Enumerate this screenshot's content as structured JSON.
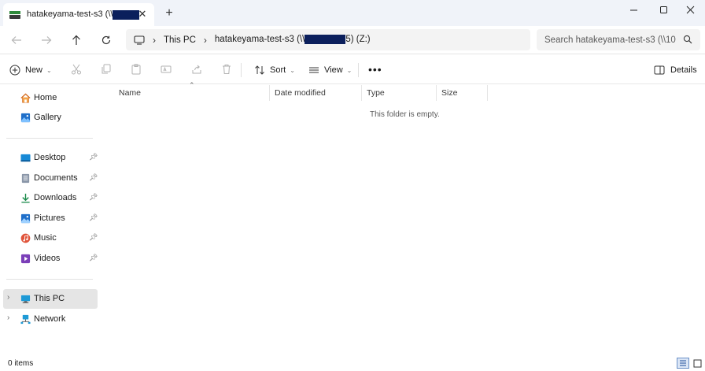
{
  "tab": {
    "title_prefix": "hatakeyama-test-s3 (\\\\"
  },
  "address": {
    "crumb_root": "This PC",
    "crumb_drive_prefix": "hatakeyama-test-s3 (\\\\",
    "crumb_drive_suffix": "5) (Z:)"
  },
  "search": {
    "placeholder": "Search hatakeyama-test-s3 (\\\\10"
  },
  "commands": {
    "new_label": "New",
    "sort_label": "Sort",
    "view_label": "View",
    "more_label": "•••",
    "details_label": "Details"
  },
  "sidebar": {
    "quick": [
      {
        "label": "Home",
        "icon": "home-icon"
      },
      {
        "label": "Gallery",
        "icon": "gallery-icon"
      }
    ],
    "pinned": [
      {
        "label": "Desktop",
        "icon": "desktop-icon"
      },
      {
        "label": "Documents",
        "icon": "documents-icon"
      },
      {
        "label": "Downloads",
        "icon": "downloads-icon"
      },
      {
        "label": "Pictures",
        "icon": "pictures-icon"
      },
      {
        "label": "Music",
        "icon": "music-icon"
      },
      {
        "label": "Videos",
        "icon": "videos-icon"
      }
    ],
    "drives": [
      {
        "label": "This PC",
        "icon": "this-pc-icon",
        "selected": true
      },
      {
        "label": "Network",
        "icon": "network-icon"
      }
    ]
  },
  "columns": {
    "name": "Name",
    "date_modified": "Date modified",
    "type": "Type",
    "size": "Size"
  },
  "content": {
    "empty_message": "This folder is empty."
  },
  "status": {
    "item_count": "0 items"
  },
  "colors": {
    "accent": "#0067c0",
    "redaction": "#0b1f5c",
    "selected_bg": "#e5e5e5"
  }
}
